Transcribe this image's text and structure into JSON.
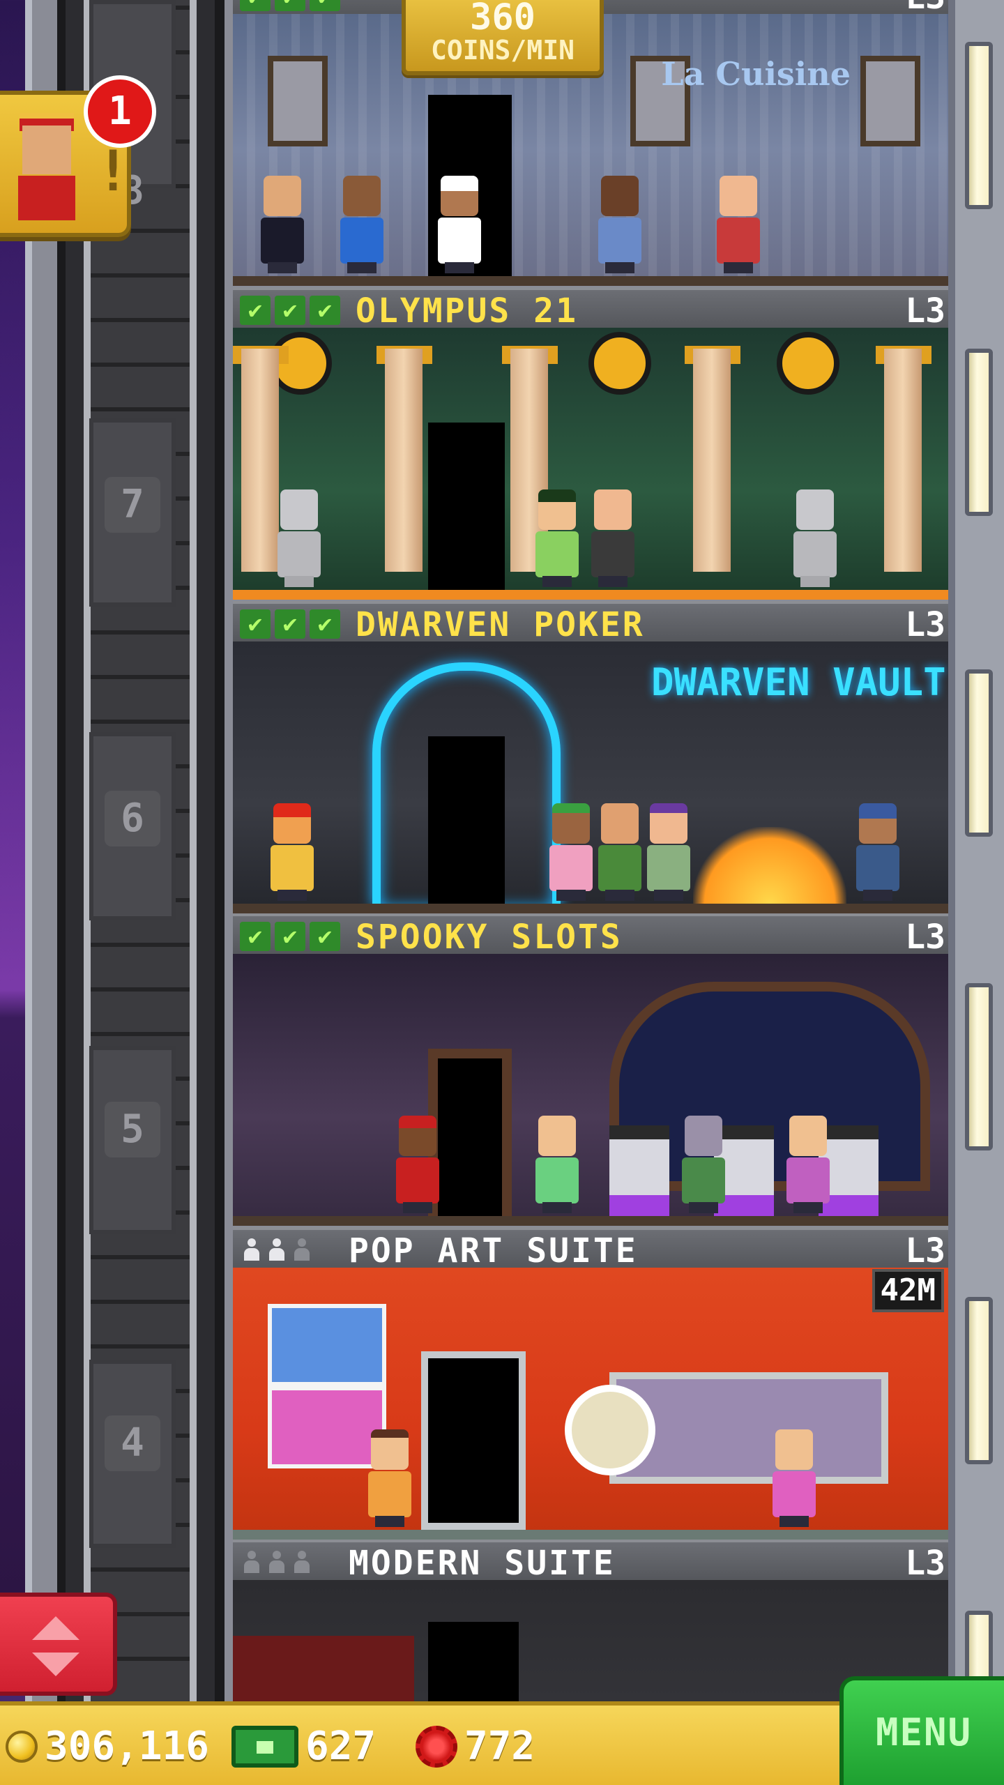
{
  "game": {
    "coins_per_min": {
      "value": "360",
      "label": "COINS/MIN"
    },
    "notification": {
      "count": "1",
      "icon": "bellhop-icon"
    },
    "colors": {
      "header_yellow": "#ffe24a",
      "bar_gold": "#e8b830",
      "menu_green": "#1ea030",
      "elevator_red": "#d02030"
    }
  },
  "shaft": {
    "floor_numbers": [
      "8",
      "7",
      "6",
      "5",
      "4"
    ]
  },
  "floors": [
    {
      "name": "",
      "level": "L3",
      "status": "stocked",
      "theme": "restaurant",
      "sign": "La Cuisine"
    },
    {
      "name": "OLYMPUS 21",
      "level": "L3",
      "status": "stocked",
      "theme": "casino-olympus"
    },
    {
      "name": "DWARVEN POKER",
      "level": "L3",
      "status": "stocked",
      "theme": "casino-dwarven",
      "sign": "DWARVEN VAULT"
    },
    {
      "name": "SPOOKY SLOTS",
      "level": "L3",
      "status": "stocked",
      "theme": "casino-spooky"
    },
    {
      "name": "POP ART SUITE",
      "level": "L3",
      "status": "residential",
      "theme": "residence-popart",
      "timer": "42M"
    },
    {
      "name": "MODERN SUITE",
      "level": "L3",
      "status": "residential",
      "theme": "residence-modern"
    }
  ],
  "bottom_bar": {
    "coins": "306,116",
    "bux": "627",
    "tokens": "772",
    "menu_label": "MENU"
  }
}
